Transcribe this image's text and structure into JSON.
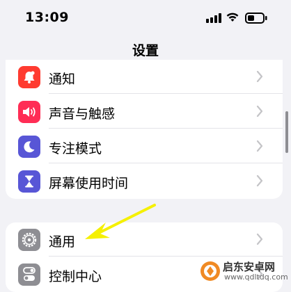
{
  "status_bar": {
    "time": "13:09"
  },
  "nav": {
    "title": "设置"
  },
  "group1": [
    {
      "label": "通知",
      "icon": "bell-icon",
      "color": "#ff3b30"
    },
    {
      "label": "声音与触感",
      "icon": "speaker-icon",
      "color": "#ff2d55"
    },
    {
      "label": "专注模式",
      "icon": "moon-icon",
      "color": "#5856d6"
    },
    {
      "label": "屏幕使用时间",
      "icon": "hourglass-icon",
      "color": "#5856d6"
    }
  ],
  "group2": [
    {
      "label": "通用",
      "icon": "gear-icon",
      "color": "#8e8e93"
    },
    {
      "label": "控制中心",
      "icon": "toggles-icon",
      "color": "#8e8e93"
    }
  ],
  "watermark": {
    "name": "启东安卓网",
    "url": "www.qdltdq.com",
    "accent": "#f08a24"
  }
}
